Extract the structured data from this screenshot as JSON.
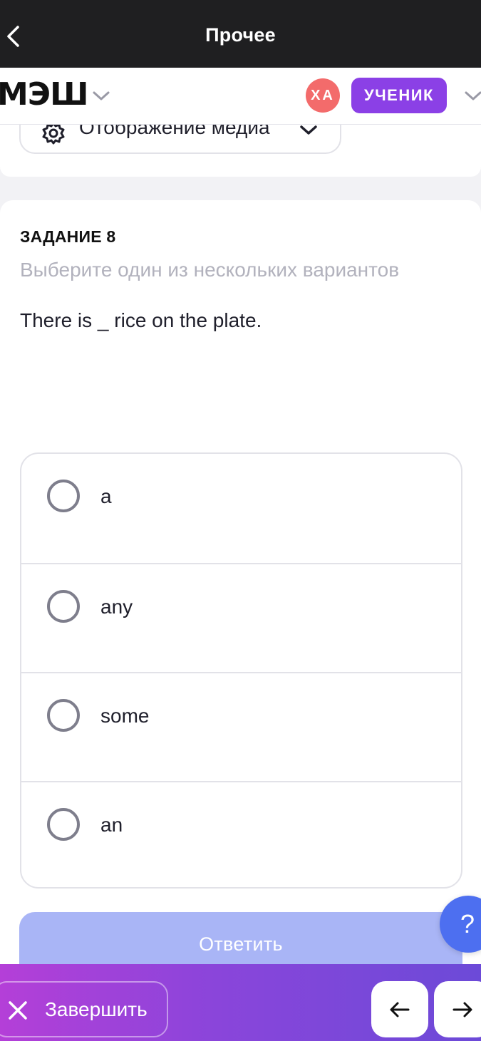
{
  "topbar": {
    "title": "Прочее"
  },
  "header": {
    "logo": "МЭШ",
    "avatar_initials": "ХА",
    "role": "УЧЕНИК"
  },
  "media": {
    "label": "Отображение медиа"
  },
  "task": {
    "title": "ЗАДАНИЕ 8",
    "subtitle": "Выберите один из нескольких вариантов",
    "question": "There is _ rice on the plate.",
    "options": [
      {
        "label": "a",
        "selected": false
      },
      {
        "label": "any",
        "selected": false
      },
      {
        "label": "some",
        "selected": false
      },
      {
        "label": "an",
        "selected": false
      }
    ],
    "submit_label": "Ответить"
  },
  "help": {
    "label": "?"
  },
  "bottom": {
    "finish_label": "Завершить"
  },
  "colors": {
    "topbar": "#1f1f21",
    "role_badge": "#8b40e6",
    "avatar": "#f36b6b",
    "submit_disabled": "#a9b5f6",
    "help": "#4d6ff0",
    "bottom_gradient_start": "#b43fd8",
    "bottom_gradient_end": "#6c4ad8"
  },
  "icons": [
    "back-arrow-icon",
    "chevron-down-icon",
    "gear-icon",
    "close-icon",
    "arrow-left-icon",
    "arrow-right-icon",
    "help-icon"
  ]
}
